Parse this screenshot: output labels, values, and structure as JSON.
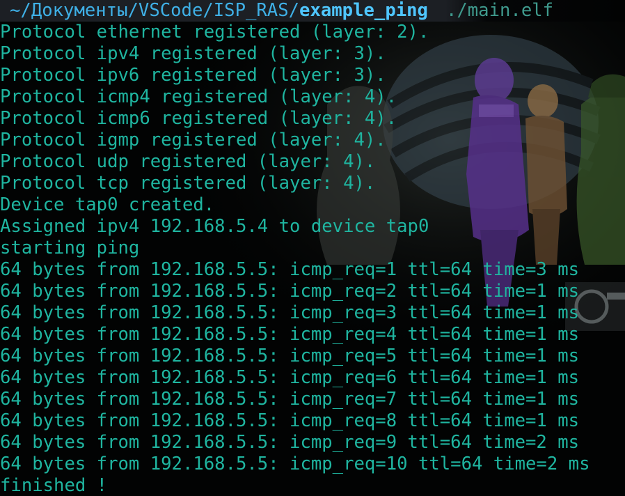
{
  "window": {
    "title": "~/Документы/VSCode/ISP_RAS/example_ping"
  },
  "prompt": {
    "path_prefix": "~/Документы/VSCode/ISP_RAS/",
    "current_dir": "example_ping",
    "separator": "",
    "command": "./main.elf"
  },
  "output": [
    "Protocol ethernet registered (layer: 2).",
    "Protocol ipv4 registered (layer: 3).",
    "Protocol ipv6 registered (layer: 3).",
    "Protocol icmp4 registered (layer: 4).",
    "Protocol icmp6 registered (layer: 4).",
    "Protocol igmp registered (layer: 4).",
    "Protocol udp registered (layer: 4).",
    "Protocol tcp registered (layer: 4).",
    "Device tap0 created.",
    "Assigned ipv4 192.168.5.4 to device tap0",
    "starting ping",
    "64 bytes from 192.168.5.5: icmp_req=1 ttl=64 time=3 ms",
    "64 bytes from 192.168.5.5: icmp_req=2 ttl=64 time=1 ms",
    "64 bytes from 192.168.5.5: icmp_req=3 ttl=64 time=1 ms",
    "64 bytes from 192.168.5.5: icmp_req=4 ttl=64 time=1 ms",
    "64 bytes from 192.168.5.5: icmp_req=5 ttl=64 time=1 ms",
    "64 bytes from 192.168.5.5: icmp_req=6 ttl=64 time=1 ms",
    "64 bytes from 192.168.5.5: icmp_req=7 ttl=64 time=1 ms",
    "64 bytes from 192.168.5.5: icmp_req=8 ttl=64 time=1 ms",
    "64 bytes from 192.168.5.5: icmp_req=9 ttl=64 time=2 ms",
    "64 bytes from 192.168.5.5: icmp_req=10 ttl=64 time=2 ms",
    "finished !"
  ],
  "colors": {
    "background": "#020303",
    "output_text": "#1fb5a0",
    "prompt_path": "#3fb0e6",
    "prompt_cwd": "#4fc6ff",
    "prompt_command": "#3f9a8d"
  },
  "wallpaper": {
    "icon": "anime-characters-wallpaper"
  }
}
